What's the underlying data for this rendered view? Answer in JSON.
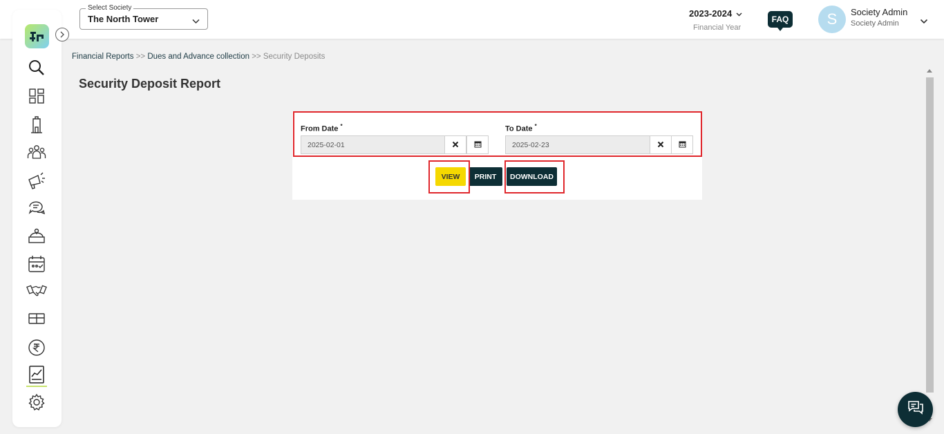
{
  "header": {
    "society_select_label": "Select Society",
    "society_value": "The North Tower",
    "financial_year": "2023-2024",
    "financial_year_label": "Financial Year",
    "faq_label": "FAQ",
    "user_initial": "S",
    "user_name": "Society Admin",
    "user_role": "Society Admin"
  },
  "logo_text": "ᵭr",
  "sidebar": {
    "items": [
      {
        "icon": "search-icon"
      },
      {
        "icon": "dashboard-icon"
      },
      {
        "icon": "building-icon"
      },
      {
        "icon": "people-icon"
      },
      {
        "icon": "megaphone-icon"
      },
      {
        "icon": "chat-icon"
      },
      {
        "icon": "helpdesk-icon"
      },
      {
        "icon": "calendar-icon"
      },
      {
        "icon": "handshake-icon"
      },
      {
        "icon": "amenity-icon"
      },
      {
        "icon": "rupee-icon"
      },
      {
        "icon": "reports-icon",
        "active": true
      },
      {
        "icon": "settings-icon"
      }
    ]
  },
  "breadcrumb": {
    "item1": "Financial Reports",
    "sep1": ">>",
    "item2": "Dues and Advance collection",
    "sep2": ">>",
    "current": "Security Deposits"
  },
  "page_title": "Security Deposit Report",
  "form": {
    "from_label": "From Date",
    "from_value": "2025-02-01",
    "to_label": "To Date",
    "to_value": "2025-02-23",
    "required_mark": "*"
  },
  "buttons": {
    "view": "VIEW",
    "print": "PRINT",
    "download": "DOWNLOAD"
  },
  "colors": {
    "primary_dark": "#0d2e35",
    "accent_yellow": "#f5d800",
    "highlight_red": "#e0262b"
  }
}
